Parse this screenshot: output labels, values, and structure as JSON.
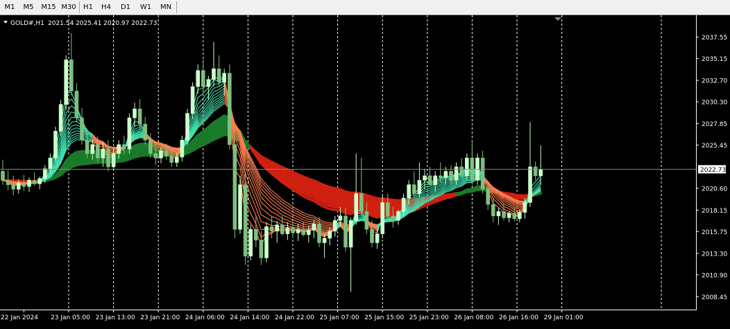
{
  "toolbar": {
    "timeframes": [
      "M1",
      "M5",
      "M15",
      "M30",
      "H1",
      "H4",
      "D1",
      "W1",
      "MN"
    ]
  },
  "header": {
    "symbol_timeframe": "GOLD#,H1",
    "ohlc": "2021.54 2025.41 2020.97 2022.73"
  },
  "colors": {
    "background": "#000000",
    "bull_candle": "#ccffcc",
    "bear_candle": "#7fbf7f",
    "fast_ribbon": "#40e0b0",
    "fast_ribbon_bear": "#ff7f50",
    "slow_ribbon_bull": "#1a7a2a",
    "slow_ribbon_bear": "#d02010",
    "grid": "#ffffff",
    "axis_text": "#ffffff",
    "price_label_bg": "#ffffff"
  },
  "chart_data": {
    "type": "candlestick",
    "title": "GOLD#,H1",
    "y_ticks": [
      "2037.55",
      "2035.15",
      "2032.70",
      "2030.30",
      "2027.85",
      "2025.45",
      "2020.60",
      "2018.15",
      "2015.75",
      "2013.30",
      "2010.90",
      "2008.45"
    ],
    "current_price": "2022.73",
    "ylim": [
      2007.0,
      2040.0
    ],
    "x_ticks": [
      "22 Jan 2024",
      "23 Jan 05:00",
      "23 Jan 13:00",
      "23 Jan 21:00",
      "24 Jan 06:00",
      "24 Jan 14:00",
      "24 Jan 22:00",
      "25 Jan 07:00",
      "25 Jan 15:00",
      "25 Jan 23:00",
      "26 Jan 08:00",
      "26 Jan 16:00",
      "29 Jan 01:00"
    ],
    "grid": "vertical dashed",
    "candles": [
      [
        2022.5,
        2023.8,
        2021.0,
        2021.5
      ],
      [
        2021.5,
        2022.6,
        2020.4,
        2021.0
      ],
      [
        2021.0,
        2022.0,
        2019.8,
        2020.5
      ],
      [
        2020.5,
        2021.6,
        2020.0,
        2021.2
      ],
      [
        2021.2,
        2022.1,
        2020.3,
        2020.8
      ],
      [
        2020.8,
        2021.8,
        2020.2,
        2021.5
      ],
      [
        2021.5,
        2022.4,
        2020.9,
        2021.1
      ],
      [
        2021.1,
        2021.9,
        2020.5,
        2021.7
      ],
      [
        2021.7,
        2023.2,
        2021.2,
        2022.8
      ],
      [
        2022.8,
        2024.5,
        2022.2,
        2024.0
      ],
      [
        2024.0,
        2027.5,
        2023.6,
        2027.0
      ],
      [
        2027.0,
        2030.5,
        2026.5,
        2030.0
      ],
      [
        2030.0,
        2035.5,
        2029.4,
        2035.0
      ],
      [
        2035.0,
        2038.0,
        2031.0,
        2031.5
      ],
      [
        2031.5,
        2032.4,
        2028.0,
        2028.5
      ],
      [
        2028.5,
        2029.6,
        2025.5,
        2026.0
      ],
      [
        2026.0,
        2027.3,
        2024.0,
        2024.5
      ],
      [
        2024.5,
        2026.1,
        2023.8,
        2025.5
      ],
      [
        2025.5,
        2026.4,
        2023.5,
        2024.0
      ],
      [
        2024.0,
        2025.7,
        2023.0,
        2025.0
      ],
      [
        2025.0,
        2026.0,
        2022.5,
        2023.0
      ],
      [
        2023.0,
        2025.1,
        2022.6,
        2024.5
      ],
      [
        2024.5,
        2026.0,
        2023.9,
        2025.5
      ],
      [
        2025.5,
        2026.5,
        2024.4,
        2025.0
      ],
      [
        2025.0,
        2029.0,
        2024.5,
        2028.5
      ],
      [
        2028.5,
        2030.2,
        2027.5,
        2029.5
      ],
      [
        2029.5,
        2030.6,
        2027.2,
        2027.8
      ],
      [
        2027.8,
        2028.6,
        2025.5,
        2026.0
      ],
      [
        2026.0,
        2026.8,
        2024.0,
        2024.5
      ],
      [
        2024.5,
        2025.3,
        2023.2,
        2024.0
      ],
      [
        2024.0,
        2025.2,
        2023.4,
        2024.8
      ],
      [
        2024.8,
        2025.6,
        2023.8,
        2024.2
      ],
      [
        2024.2,
        2025.0,
        2023.0,
        2023.5
      ],
      [
        2023.5,
        2024.6,
        2023.0,
        2024.1
      ],
      [
        2024.1,
        2026.5,
        2023.6,
        2026.0
      ],
      [
        2026.0,
        2029.5,
        2025.5,
        2029.0
      ],
      [
        2029.0,
        2032.5,
        2028.4,
        2032.0
      ],
      [
        2032.0,
        2034.5,
        2031.2,
        2033.8
      ],
      [
        2033.8,
        2035.0,
        2031.5,
        2032.0
      ],
      [
        2032.0,
        2033.2,
        2030.5,
        2032.8
      ],
      [
        2032.8,
        2037.0,
        2032.0,
        2034.0
      ],
      [
        2034.0,
        2035.5,
        2032.0,
        2032.5
      ],
      [
        2032.5,
        2034.0,
        2031.0,
        2033.5
      ],
      [
        2033.5,
        2034.5,
        2025.0,
        2025.5
      ],
      [
        2025.5,
        2026.0,
        2015.0,
        2016.0
      ],
      [
        2016.0,
        2022.0,
        2015.5,
        2021.0
      ],
      [
        2021.0,
        2022.5,
        2012.0,
        2013.0
      ],
      [
        2013.0,
        2016.5,
        2012.5,
        2016.0
      ],
      [
        2016.0,
        2017.5,
        2014.0,
        2014.8
      ],
      [
        2014.8,
        2015.8,
        2012.0,
        2012.8
      ],
      [
        2012.8,
        2016.8,
        2012.3,
        2016.3
      ],
      [
        2016.3,
        2017.5,
        2015.0,
        2015.8
      ],
      [
        2015.8,
        2016.9,
        2014.5,
        2016.5
      ],
      [
        2016.5,
        2017.5,
        2015.3,
        2015.5
      ],
      [
        2015.5,
        2016.8,
        2014.8,
        2016.2
      ],
      [
        2016.2,
        2016.9,
        2015.0,
        2015.6
      ],
      [
        2015.6,
        2016.6,
        2014.7,
        2016.0
      ],
      [
        2016.0,
        2016.8,
        2015.2,
        2015.4
      ],
      [
        2015.4,
        2016.4,
        2014.5,
        2015.9
      ],
      [
        2015.9,
        2017.0,
        2015.0,
        2016.6
      ],
      [
        2016.6,
        2017.4,
        2014.0,
        2014.5
      ],
      [
        2014.5,
        2015.5,
        2012.8,
        2015.0
      ],
      [
        2015.0,
        2016.2,
        2014.2,
        2015.8
      ],
      [
        2015.8,
        2017.5,
        2015.2,
        2017.0
      ],
      [
        2017.0,
        2018.5,
        2016.4,
        2017.5
      ],
      [
        2017.5,
        2018.4,
        2013.5,
        2014.0
      ],
      [
        2014.0,
        2017.3,
        2009.0,
        2017.0
      ],
      [
        2017.0,
        2024.5,
        2016.5,
        2020.0
      ],
      [
        2020.0,
        2024.0,
        2017.5,
        2018.0
      ],
      [
        2018.0,
        2019.0,
        2015.5,
        2016.0
      ],
      [
        2016.0,
        2017.0,
        2014.0,
        2014.5
      ],
      [
        2014.5,
        2016.0,
        2013.8,
        2015.5
      ],
      [
        2015.5,
        2019.8,
        2015.0,
        2019.0
      ],
      [
        2019.0,
        2020.0,
        2016.8,
        2017.5
      ],
      [
        2017.5,
        2018.5,
        2016.2,
        2017.0
      ],
      [
        2017.0,
        2018.2,
        2016.5,
        2018.0
      ],
      [
        2018.0,
        2020.0,
        2017.5,
        2019.5
      ],
      [
        2019.5,
        2021.5,
        2018.8,
        2021.0
      ],
      [
        2021.0,
        2022.5,
        2019.5,
        2020.0
      ],
      [
        2020.0,
        2023.5,
        2019.6,
        2021.5
      ],
      [
        2021.5,
        2022.8,
        2020.5,
        2022.0
      ],
      [
        2022.0,
        2023.0,
        2020.8,
        2021.0
      ],
      [
        2021.0,
        2022.5,
        2020.2,
        2022.0
      ],
      [
        2022.0,
        2023.5,
        2021.2,
        2021.8
      ],
      [
        2021.8,
        2023.0,
        2021.0,
        2022.5
      ],
      [
        2022.5,
        2023.2,
        2021.0,
        2021.5
      ],
      [
        2021.5,
        2023.5,
        2021.0,
        2023.0
      ],
      [
        2023.0,
        2024.0,
        2021.8,
        2022.0
      ],
      [
        2022.0,
        2024.5,
        2021.5,
        2024.0
      ],
      [
        2024.0,
        2026.0,
        2021.0,
        2021.5
      ],
      [
        2021.5,
        2024.5,
        2021.0,
        2024.0
      ],
      [
        2024.0,
        2024.8,
        2020.0,
        2020.5
      ],
      [
        2020.5,
        2021.2,
        2018.2,
        2018.8
      ],
      [
        2018.8,
        2019.6,
        2016.8,
        2017.5
      ],
      [
        2017.5,
        2018.4,
        2016.5,
        2018.0
      ],
      [
        2018.0,
        2018.9,
        2017.0,
        2017.3
      ],
      [
        2017.3,
        2018.0,
        2016.8,
        2017.8
      ],
      [
        2017.8,
        2018.5,
        2016.9,
        2017.2
      ],
      [
        2017.2,
        2018.2,
        2016.8,
        2017.9
      ],
      [
        2017.9,
        2019.5,
        2017.2,
        2019.0
      ],
      [
        2019.0,
        2028.0,
        2018.5,
        2023.0
      ],
      [
        2023.0,
        2023.6,
        2021.5,
        2022.0
      ],
      [
        2022.0,
        2025.41,
        2020.97,
        2022.73
      ]
    ]
  }
}
